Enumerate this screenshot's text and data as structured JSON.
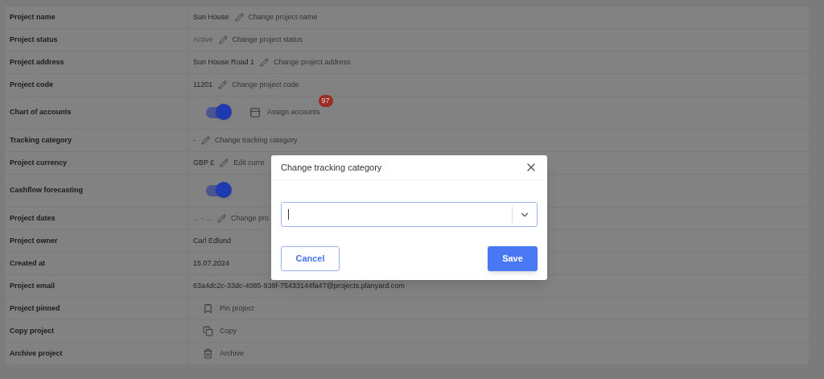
{
  "rows": [
    {
      "label": "Project name",
      "kind": "edit",
      "value": "Sun House",
      "muted": false,
      "action": "Change project name"
    },
    {
      "label": "Project status",
      "kind": "edit",
      "value": "Active",
      "muted": true,
      "action": "Change project status"
    },
    {
      "label": "Project address",
      "kind": "edit",
      "value": "Sun House Road 1",
      "muted": false,
      "action": "Change project address"
    },
    {
      "label": "Project code",
      "kind": "edit",
      "value": "11201",
      "muted": false,
      "action": "Change project code"
    },
    {
      "label": "Chart of accounts",
      "kind": "toggle",
      "on": true,
      "action": "Assign accounts",
      "badge": "97"
    },
    {
      "label": "Tracking category",
      "kind": "edit",
      "value": "-",
      "muted": false,
      "action": "Change tracking category"
    },
    {
      "label": "Project currency",
      "kind": "edit",
      "value": "GBP £",
      "muted": false,
      "action": "Edit curre"
    },
    {
      "label": "Cashflow forecasting",
      "kind": "toggle",
      "on": true
    },
    {
      "label": "Project dates",
      "kind": "edit",
      "value": "... - ...",
      "muted": true,
      "action": "Change pro"
    },
    {
      "label": "Project owner",
      "kind": "text",
      "value": "Carl Edlund"
    },
    {
      "label": "Created at",
      "kind": "text",
      "value": "15.07.2024"
    },
    {
      "label": "Project email",
      "kind": "text",
      "value": "63a4dc2c-33dc-4085-939f-75433144fa47@projects.planyard.com"
    },
    {
      "label": "Project pinned",
      "kind": "pin",
      "action": "Pin project"
    },
    {
      "label": "Copy project",
      "kind": "copy",
      "action": "Copy"
    },
    {
      "label": "Archive project",
      "kind": "archive",
      "action": "Archive"
    }
  ],
  "dialog": {
    "title": "Change tracking category",
    "buttons": {
      "cancel": "Cancel",
      "save": "Save"
    }
  }
}
